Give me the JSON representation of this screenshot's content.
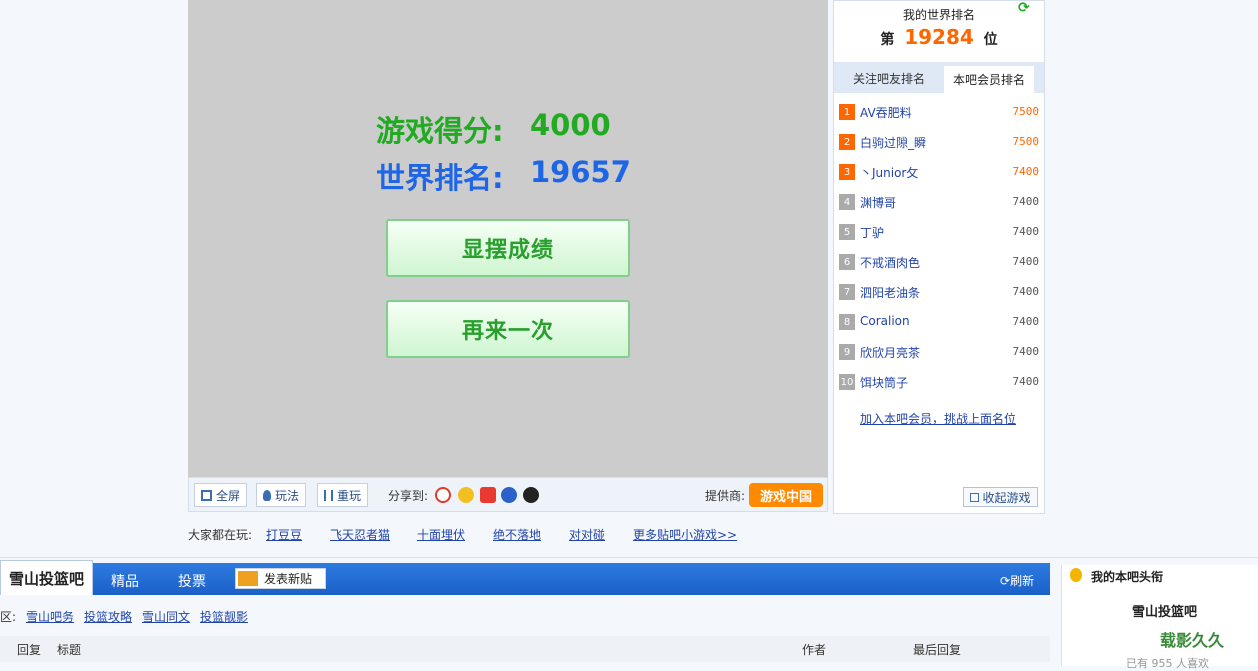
{
  "game": {
    "score_label": "游戏得分:",
    "score_value": "4000",
    "rank_label": "世界排名:",
    "rank_value": "19657",
    "show_button": "显摆成绩",
    "retry_button": "再来一次"
  },
  "game_tools": {
    "fullscreen": "全屏",
    "howto": "玩法",
    "replay": "重玩",
    "share_label": "分享到:",
    "provider_label": "提供商:",
    "provider_logo": "游戏中国"
  },
  "playing": {
    "label": "大家都在玩:",
    "links": [
      "打豆豆",
      "飞天忍者猫",
      "十面埋伏",
      "绝不落地",
      "对对碰",
      "更多贴吧小游戏>>"
    ]
  },
  "ranking": {
    "title": "我的世界排名",
    "prefix": "第",
    "value": "19284",
    "suffix": "位",
    "tabs": [
      "关注吧友排名",
      "本吧会员排名"
    ],
    "rows": [
      {
        "rank": "1",
        "name": "AV吞肥料",
        "score": "7500"
      },
      {
        "rank": "2",
        "name": "白驹过隙_瞬",
        "score": "7500"
      },
      {
        "rank": "3",
        "name": "丶Junior攵",
        "score": "7400"
      },
      {
        "rank": "4",
        "name": "渊博哥",
        "score": "7400"
      },
      {
        "rank": "5",
        "name": "丁驴",
        "score": "7400"
      },
      {
        "rank": "6",
        "name": "不戒酒肉色",
        "score": "7400"
      },
      {
        "rank": "7",
        "name": "泗阳老油条",
        "score": "7400"
      },
      {
        "rank": "8",
        "name": "Coralion",
        "score": "7400"
      },
      {
        "rank": "9",
        "name": "欣欣月亮茶",
        "score": "7400"
      },
      {
        "rank": "10",
        "name": "饵块筒子",
        "score": "7400"
      }
    ],
    "join_link": "加入本吧会员，挑战上面名位",
    "collapse_button": "收起游戏",
    "colors": {
      "top": "#ff6600",
      "other": "#aaaaaa"
    }
  },
  "forum": {
    "name": "雪山投篮吧",
    "tabs": [
      "精品",
      "投票"
    ],
    "post_button": "发表新贴",
    "refresh": "刷新",
    "sub_label": "区:",
    "sub_links": [
      "雪山吧务",
      "投篮攻略",
      "雪山同文",
      "投篮靓影"
    ],
    "columns": {
      "reply": "回复",
      "title": "标题",
      "author": "作者",
      "last": "最后回复"
    }
  },
  "sidebar": {
    "title": "我的本吧头衔",
    "bar_name": "雪山投篮吧",
    "like_count": "已有 955 人喜欢",
    "watermark": "载影久久"
  }
}
